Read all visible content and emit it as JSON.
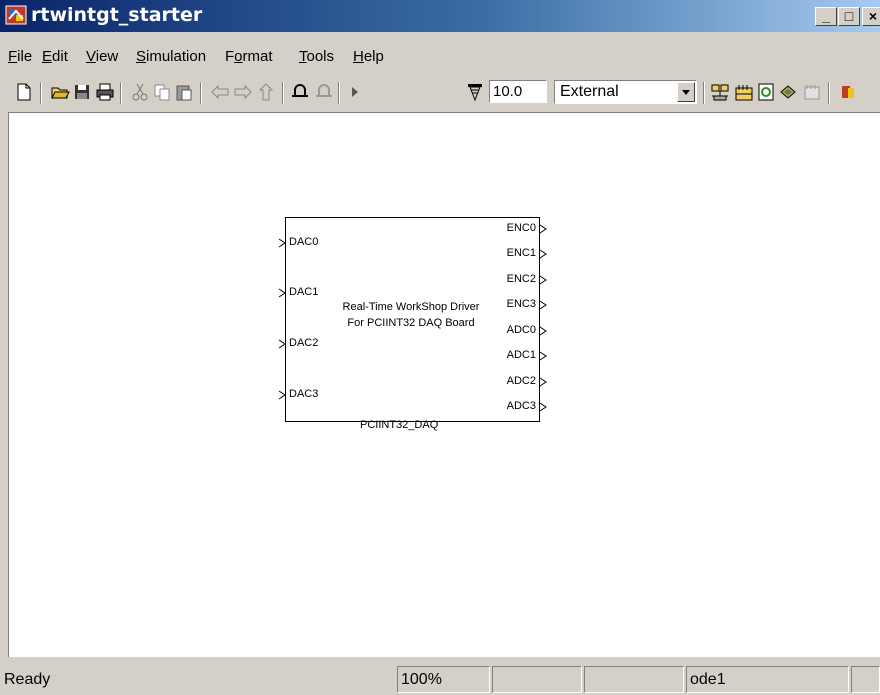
{
  "window": {
    "title": "rtwintgt_starter",
    "controls": {
      "minimize": "_",
      "maximize": "□",
      "close": "×"
    }
  },
  "menu": {
    "items": [
      {
        "label": "File",
        "mnemonic": "F"
      },
      {
        "label": "Edit",
        "mnemonic": "E"
      },
      {
        "label": "View",
        "mnemonic": "V"
      },
      {
        "label": "Simulation",
        "mnemonic": "S"
      },
      {
        "label": "Format",
        "mnemonic": "o"
      },
      {
        "label": "Tools",
        "mnemonic": "T"
      },
      {
        "label": "Help",
        "mnemonic": "H"
      }
    ]
  },
  "toolbar": {
    "stop_time": "10.0",
    "simulation_mode": "External",
    "icons": [
      "new-model-icon",
      "open-icon",
      "save-icon",
      "print-icon",
      "cut-icon",
      "copy-icon",
      "paste-icon",
      "back-icon",
      "forward-icon",
      "up-icon",
      "undo-icon",
      "redo-icon",
      "start-icon",
      "stop-time-icon",
      "build-icon",
      "library-browser-icon",
      "refresh-icon",
      "model-explorer-icon",
      "debugger-icon",
      "extra-icon"
    ]
  },
  "block": {
    "name": "PCIINT32_DAQ",
    "description_line1": "Real-Time WorkShop Driver",
    "description_line2": "For PCIINT32 DAQ Board",
    "inputs": [
      "DAC0",
      "DAC1",
      "DAC2",
      "DAC3"
    ],
    "outputs": [
      "ENC0",
      "ENC1",
      "ENC2",
      "ENC3",
      "ADC0",
      "ADC1",
      "ADC2",
      "ADC3"
    ]
  },
  "status": {
    "state": "Ready",
    "zoom": "100%",
    "pane3": "",
    "pane4": "",
    "solver": "ode1"
  },
  "colors": {
    "titlebar_start": "#0a246a",
    "titlebar_end": "#a6caf0",
    "chrome": "#d4d0c8",
    "canvas": "#ffffff"
  }
}
